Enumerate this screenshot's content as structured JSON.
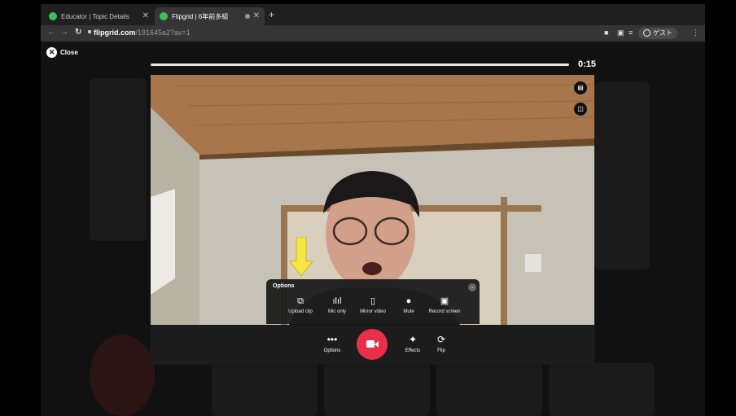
{
  "browser": {
    "tabs": [
      {
        "label": "Educator | Topic Details",
        "active": false
      },
      {
        "label": "Flipgrid | 6年前多組",
        "active": true
      }
    ],
    "new_tab": "+",
    "url_host": "flipgrid.com",
    "url_rest": "/191645a2?av=1",
    "profile_label": "ゲスト"
  },
  "recorder": {
    "close_label": "Close",
    "timer": "0:15",
    "progress_fraction": 0.97,
    "video_placeholder": "[photo]",
    "options_panel": {
      "title": "Options",
      "items": [
        {
          "label": "Upload clip",
          "icon": "upload-clip-icon"
        },
        {
          "label": "Mic only",
          "icon": "mic-only-icon"
        },
        {
          "label": "Mirror video",
          "icon": "mirror-video-icon"
        },
        {
          "label": "Mute",
          "icon": "microphone-icon"
        },
        {
          "label": "Record screen",
          "icon": "record-screen-icon"
        }
      ]
    },
    "controls": {
      "options_label": "Options",
      "effects_label": "Effects",
      "flip_label": "Flip"
    }
  },
  "colors": {
    "record_button": "#e8304a",
    "highlight_arrow": "#f5e642",
    "favicon": "#3fbf5a"
  }
}
